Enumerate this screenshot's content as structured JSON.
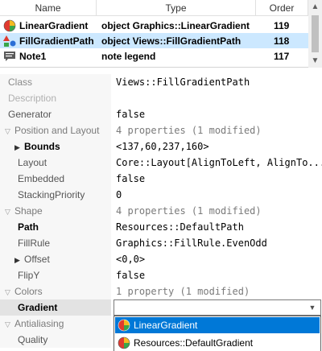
{
  "list": {
    "columns": {
      "name": "Name",
      "type": "Type",
      "order": "Order"
    },
    "rows": [
      {
        "name": "LinearGradient",
        "type": "object Graphics::LinearGradient",
        "order": "119",
        "icon": "gradient-circle-icon"
      },
      {
        "name": "FillGradientPath",
        "type": "object Views::FillGradientPath",
        "order": "118",
        "icon": "shape-icon"
      },
      {
        "name": "Note1",
        "type": "note legend",
        "order": "117",
        "icon": "note-icon"
      }
    ]
  },
  "properties": {
    "class_name": "Class",
    "class_value": "Views::FillGradientPath",
    "description_name": "Description",
    "description_value": "",
    "generator_name": "Generator",
    "generator_value": "false",
    "position_layout_name": "Position and Layout",
    "position_layout_value": "4 properties (1 modified)",
    "bounds_name": "Bounds",
    "bounds_value": "<137,60,237,160>",
    "layout_name": "Layout",
    "layout_value": "Core::Layout[AlignToLeft, AlignTo...",
    "embedded_name": "Embedded",
    "embedded_value": "false",
    "stacking_name": "StackingPriority",
    "stacking_value": "0",
    "shape_name": "Shape",
    "shape_value": "4 properties (1 modified)",
    "path_name": "Path",
    "path_value": "Resources::DefaultPath",
    "fillrule_name": "FillRule",
    "fillrule_value": "Graphics::FillRule.EvenOdd",
    "offset_name": "Offset",
    "offset_value": "<0,0>",
    "flipy_name": "FlipY",
    "flipy_value": "false",
    "colors_name": "Colors",
    "colors_value": "1 property (1 modified)",
    "gradient_name": "Gradient",
    "gradient_value": "",
    "antialiasing_name": "Antialiasing",
    "quality_name": "Quality"
  },
  "dropdown": {
    "options": [
      {
        "label": "LinearGradient",
        "icon": "gradient-circle-icon"
      },
      {
        "label": "Resources::DefaultGradient",
        "icon": "gradient-circle-icon"
      }
    ],
    "selected_index": 0
  },
  "colors": {
    "selection": "#cce8ff",
    "highlight": "#0078d7"
  }
}
